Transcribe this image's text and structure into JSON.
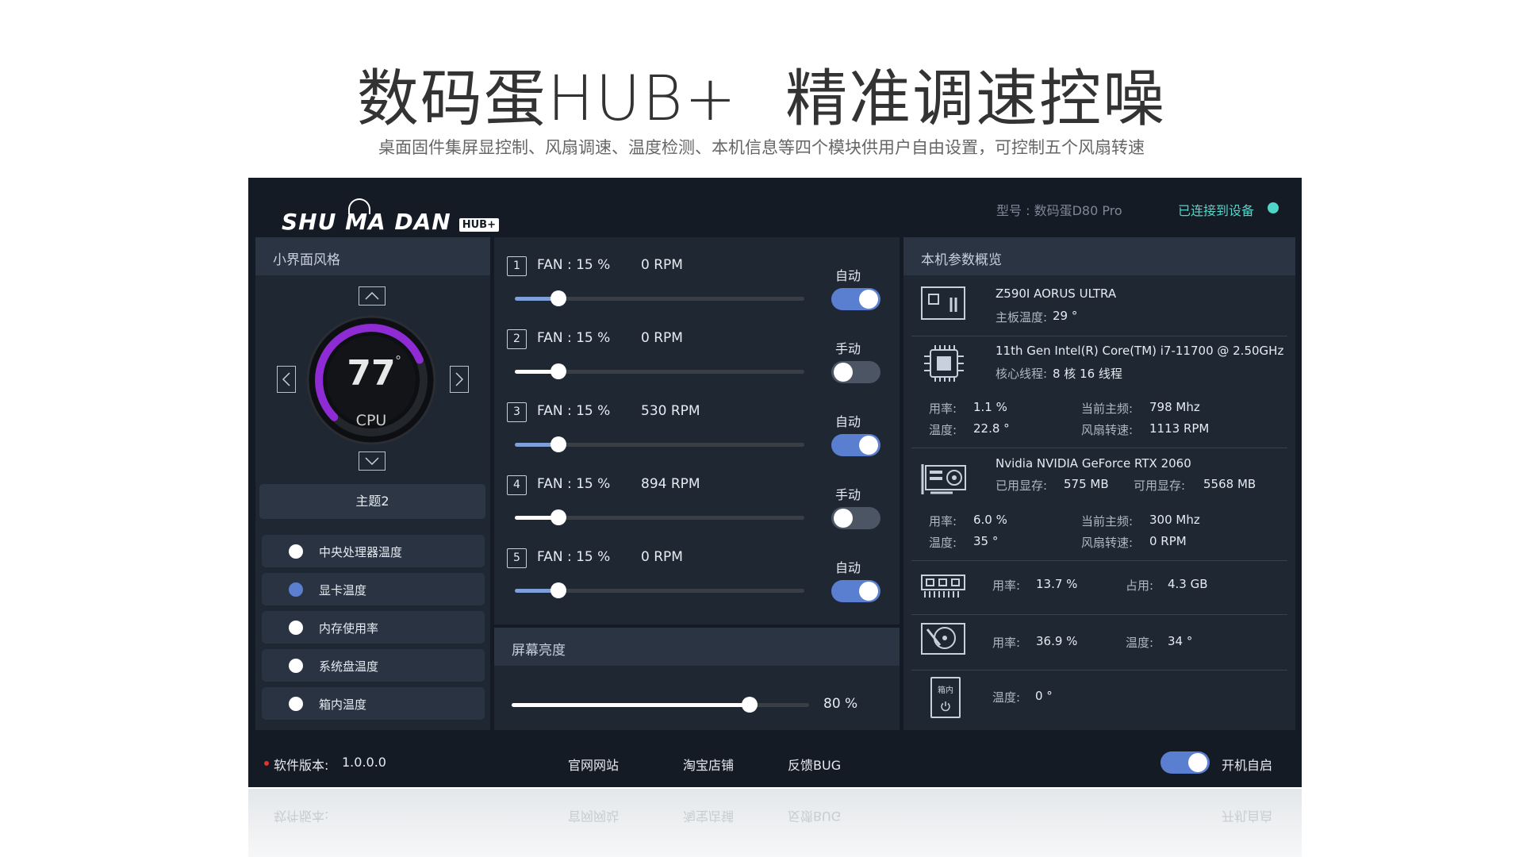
{
  "headline": {
    "part1": "数码蛋HUB+",
    "part2": "精准调速控噪"
  },
  "subline": "桌面固件集屏显控制、风扇调速、温度检测、本机信息等四个模块供用户自由设置，可控制五个风扇转速",
  "app": {
    "logo_text": "SHU MA DAN",
    "logo_badge": "HUB+",
    "model": "型号 : 数码蛋D80 Pro",
    "connection": "已连接到设备",
    "colors": {
      "accent": "#5a7fd0",
      "connected": "#4fd6c9",
      "gauge_arc": "#8e2bd4"
    }
  },
  "left": {
    "title": "小界面风格",
    "gauge": {
      "value": "77",
      "unit": "°",
      "label": "CPU"
    },
    "theme_button": "主题2",
    "options": [
      {
        "label": "中央处理器温度",
        "selected": false
      },
      {
        "label": "显卡温度",
        "selected": true
      },
      {
        "label": "内存使用率",
        "selected": false
      },
      {
        "label": "系统盘温度",
        "selected": false
      },
      {
        "label": "箱内温度",
        "selected": false
      }
    ]
  },
  "fans": [
    {
      "num": "1",
      "speed": "FAN : 15 %",
      "rpm": "0 RPM",
      "mode": "自动",
      "auto": true,
      "level": 15
    },
    {
      "num": "2",
      "speed": "FAN : 15 %",
      "rpm": "0 RPM",
      "mode": "手动",
      "auto": false,
      "level": 15
    },
    {
      "num": "3",
      "speed": "FAN : 15 %",
      "rpm": "530 RPM",
      "mode": "自动",
      "auto": true,
      "level": 15
    },
    {
      "num": "4",
      "speed": "FAN : 15 %",
      "rpm": "894 RPM",
      "mode": "手动",
      "auto": false,
      "level": 15
    },
    {
      "num": "5",
      "speed": "FAN : 15 %",
      "rpm": "0 RPM",
      "mode": "自动",
      "auto": true,
      "level": 15
    }
  ],
  "brightness": {
    "title": "屏幕亮度",
    "value_text": "80 %",
    "level": 80
  },
  "system": {
    "title": "本机参数概览",
    "motherboard": {
      "name": "Z590I AORUS ULTRA",
      "temp_label": "主板温度:",
      "temp": "29 °"
    },
    "cpu": {
      "name": "11th Gen Intel(R) Core(TM) i7-11700 @ 2.50GHz",
      "cores_label": "核心线程:",
      "cores": "8 核 16 线程",
      "usage_label": "用率:",
      "usage": "1.1 %",
      "freq_label": "当前主频:",
      "freq": "798 Mhz",
      "temp_label": "温度:",
      "temp": "22.8 °",
      "fan_label": "风扇转速:",
      "fan": "1113 RPM"
    },
    "gpu": {
      "name": "Nvidia NVIDIA GeForce RTX 2060",
      "used_label": "已用显存:",
      "used": "575 MB",
      "free_label": "可用显存:",
      "free": "5568 MB",
      "usage_label": "用率:",
      "usage": "6.0 %",
      "freq_label": "当前主频:",
      "freq": "300 Mhz",
      "temp_label": "温度:",
      "temp": "35 °",
      "fan_label": "风扇转速:",
      "fan": "0 RPM"
    },
    "memory": {
      "usage_label": "用率:",
      "usage": "13.7 %",
      "used_label": "占用:",
      "used": "4.3 GB"
    },
    "disk": {
      "usage_label": "用率:",
      "usage": "36.9 %",
      "temp_label": "温度:",
      "temp": "34 °"
    },
    "case": {
      "icon_text": "箱内",
      "temp_label": "温度:",
      "temp": "0 °"
    }
  },
  "footer": {
    "version_label": "软件版本:",
    "version": "1.0.0.0",
    "links": [
      "官网网站",
      "淘宝店铺",
      "反馈BUG"
    ],
    "autostart": "开机自启",
    "autostart_on": true
  }
}
